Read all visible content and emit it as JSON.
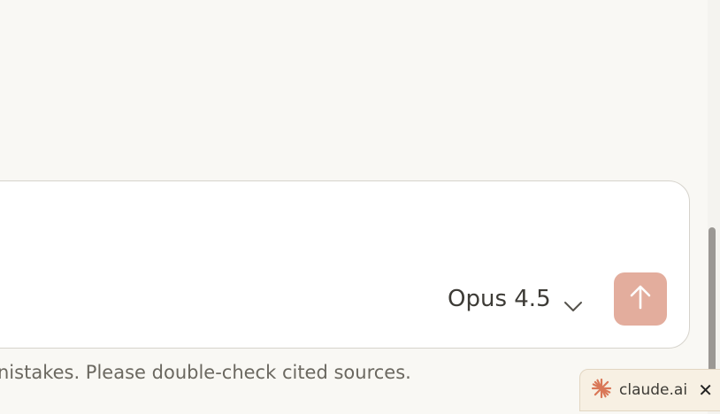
{
  "composer": {
    "model_label": "Opus 4.5",
    "send_icon": "arrow-up-icon",
    "colors": {
      "send_bg": "#e3ad9d",
      "border": "#d6d3cc"
    }
  },
  "footer": {
    "disclaimer": "nistakes. Please double-check cited sources."
  },
  "tab": {
    "label": "claude.ai",
    "icon": "claude-logo-icon",
    "close_icon": "close-icon"
  },
  "colors": {
    "background": "#f9f8f4",
    "accent": "#d97757"
  }
}
